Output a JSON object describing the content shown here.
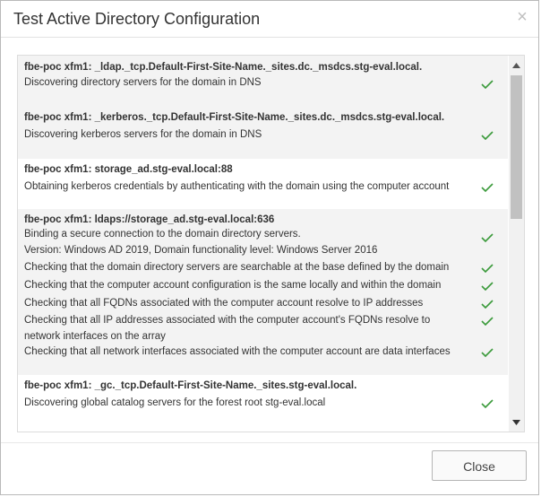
{
  "dialog": {
    "title": "Test Active Directory Configuration",
    "close_icon": "×",
    "close_button_label": "Close"
  },
  "log": {
    "check_color": "#3a9a3a",
    "entries": [
      {
        "host": "fbe-poc xfm1: _ldap._tcp.Default-First-Site-Name._sites.dc._msdcs.stg-eval.local.",
        "messages": [
          "Discovering directory servers for the domain in DNS"
        ]
      },
      {
        "host": "fbe-poc xfm1: _kerberos._tcp.Default-First-Site-Name._sites.dc._msdcs.stg-eval.local.",
        "messages": [
          "Discovering kerberos servers for the domain in DNS"
        ]
      },
      {
        "host": "fbe-poc xfm1: storage_ad.stg-eval.local:88",
        "messages": [
          "Obtaining kerberos credentials by authenticating with the domain using the computer account"
        ]
      },
      {
        "host": "fbe-poc xfm1: ldaps://storage_ad.stg-eval.local:636",
        "messages": [
          "Binding a secure connection to the domain directory servers.",
          "Version: Windows AD 2019, Domain functionality level: Windows Server 2016",
          "Checking that the domain directory servers are searchable at the base defined by the domain",
          "Checking that the computer account configuration is the same locally and within the domain",
          "Checking that all FQDNs associated with the computer account resolve to IP addresses",
          "Checking that all IP addresses associated with the computer account's FQDNs resolve to network interfaces on the array",
          "Checking that all network interfaces associated with the computer account are data interfaces"
        ]
      },
      {
        "host": "fbe-poc xfm1: _gc._tcp.Default-First-Site-Name._sites.stg-eval.local.",
        "messages": [
          "Discovering global catalog servers for the forest root stg-eval.local"
        ]
      }
    ]
  }
}
